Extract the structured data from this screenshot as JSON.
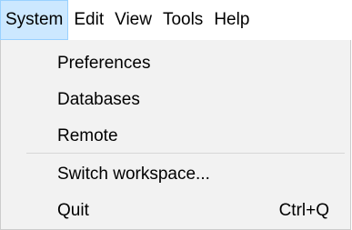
{
  "menubar": {
    "items": [
      {
        "label": "System"
      },
      {
        "label": "Edit"
      },
      {
        "label": "View"
      },
      {
        "label": "Tools"
      },
      {
        "label": "Help"
      }
    ],
    "active_index": 0
  },
  "system_menu": {
    "items": [
      {
        "label": "Preferences",
        "shortcut": ""
      },
      {
        "label": "Databases",
        "shortcut": ""
      },
      {
        "label": "Remote",
        "shortcut": ""
      },
      {
        "label": "Switch workspace...",
        "shortcut": ""
      },
      {
        "label": "Quit",
        "shortcut": "Ctrl+Q"
      }
    ]
  },
  "colors": {
    "active_menu_bg": "#cce8ff",
    "active_menu_border": "#99d1ff",
    "dropdown_bg": "#f2f2f2"
  }
}
